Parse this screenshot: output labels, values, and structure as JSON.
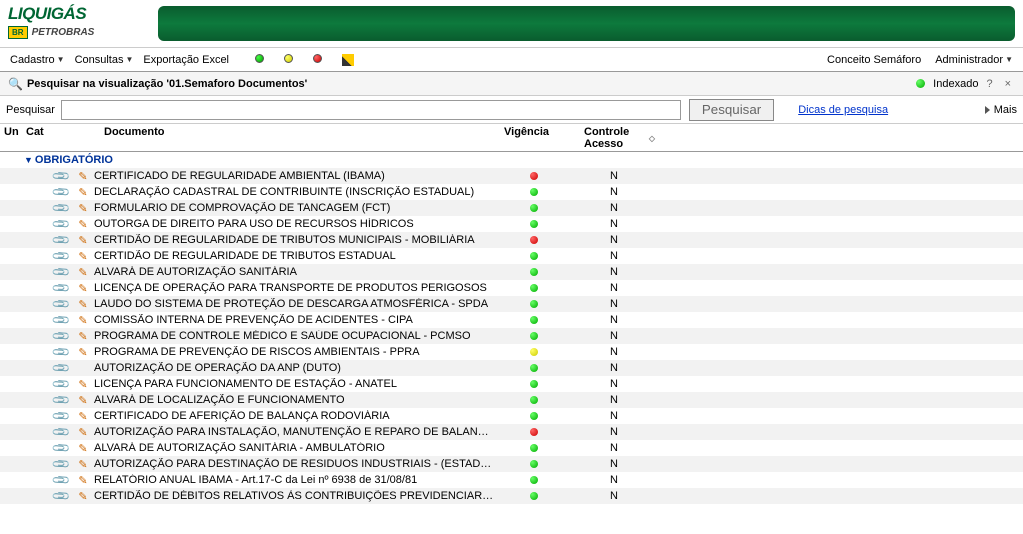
{
  "logo": {
    "main": "LIQUIGÁS",
    "br": "BR",
    "sub": "PETROBRAS"
  },
  "menu": {
    "cadastro": "Cadastro",
    "consultas": "Consultas",
    "exportacao": "Exportação Excel",
    "conceito": "Conceito Semáforo",
    "admin": "Administrador"
  },
  "searchHeader": {
    "title": "Pesquisar na visualização '01.Semaforo Documentos'",
    "indexed": "Indexado",
    "help": "?",
    "close": "×"
  },
  "searchRow": {
    "label": "Pesquisar",
    "button": "Pesquisar",
    "tips": "Dicas de pesquisa",
    "mais": "Mais"
  },
  "columns": {
    "un": "Un",
    "cat": "Cat",
    "doc": "Documento",
    "vig": "Vigência",
    "ctrl": "Controle Acesso"
  },
  "group": "OBRIGATÓRIO",
  "rows": [
    {
      "clip": true,
      "pencil": true,
      "doc": "CERTIFICADO DE REGULARIDADE AMBIENTAL (IBAMA)",
      "status": "red",
      "acesso": "N"
    },
    {
      "clip": true,
      "pencil": true,
      "doc": "DECLARAÇÃO CADASTRAL DE CONTRIBUINTE (INSCRIÇÃO ESTADUAL)",
      "status": "green",
      "acesso": "N"
    },
    {
      "clip": true,
      "pencil": true,
      "doc": "FORMULARIO DE COMPROVAÇÃO DE TANCAGEM (FCT)",
      "status": "green",
      "acesso": "N"
    },
    {
      "clip": true,
      "pencil": true,
      "doc": "OUTORGA DE DIREITO PARA USO DE RECURSOS HÍDRICOS",
      "status": "green",
      "acesso": "N"
    },
    {
      "clip": true,
      "pencil": true,
      "doc": "CERTIDÃO DE REGULARIDADE DE TRIBUTOS MUNICIPAIS - MOBILIÁRIA",
      "status": "red",
      "acesso": "N"
    },
    {
      "clip": true,
      "pencil": true,
      "doc": "CERTIDÃO DE REGULARIDADE DE TRIBUTOS ESTADUAL",
      "status": "green",
      "acesso": "N"
    },
    {
      "clip": true,
      "pencil": true,
      "doc": "ALVARÁ DE AUTORIZAÇÃO SANITÁRIA",
      "status": "green",
      "acesso": "N"
    },
    {
      "clip": true,
      "pencil": true,
      "doc": "LICENÇA DE OPERAÇÃO PARA TRANSPORTE DE PRODUTOS PERIGOSOS",
      "status": "green",
      "acesso": "N"
    },
    {
      "clip": true,
      "pencil": true,
      "doc": "LAUDO DO SISTEMA DE PROTEÇÃO DE DESCARGA ATMOSFÉRICA - SPDA",
      "status": "green",
      "acesso": "N"
    },
    {
      "clip": true,
      "pencil": true,
      "doc": "COMISSÃO INTERNA DE PREVENÇÃO DE ACIDENTES - CIPA",
      "status": "green",
      "acesso": "N"
    },
    {
      "clip": true,
      "pencil": true,
      "doc": "PROGRAMA  DE CONTROLE MÉDICO E SAÚDE OCUPACIONAL - PCMSO",
      "status": "green",
      "acesso": "N"
    },
    {
      "clip": true,
      "pencil": true,
      "doc": "PROGRAMA  DE PREVENÇÃO DE RISCOS AMBIENTAIS - PPRA",
      "status": "yellow",
      "acesso": "N"
    },
    {
      "clip": true,
      "pencil": false,
      "doc": "AUTORIZAÇÃO DE OPERAÇÃO DA ANP (DUTO)",
      "status": "green",
      "acesso": "N"
    },
    {
      "clip": true,
      "pencil": true,
      "doc": "LICENÇA PARA FUNCIONAMENTO DE ESTAÇÃO - ANATEL",
      "status": "green",
      "acesso": "N"
    },
    {
      "clip": true,
      "pencil": true,
      "doc": "ALVARÁ DE LOCALIZAÇÃO E FUNCIONAMENTO",
      "status": "green",
      "acesso": "N"
    },
    {
      "clip": true,
      "pencil": true,
      "doc": "CERTIFICADO DE AFERIÇÃO DE BALANÇA RODOVIÁRIA",
      "status": "green",
      "acesso": "N"
    },
    {
      "clip": true,
      "pencil": true,
      "doc": "AUTORIZAÇÃO PARA INSTALAÇÃO, MANUTENÇÃO E REPARO DE BALANÇAS",
      "status": "red",
      "acesso": "N"
    },
    {
      "clip": true,
      "pencil": true,
      "doc": "ALVARÁ DE AUTORIZAÇÃO SANITÁRIA - AMBULATÓRIO",
      "status": "green",
      "acesso": "N"
    },
    {
      "clip": true,
      "pencil": true,
      "doc": "AUTORIZAÇÃO PARA DESTINAÇÃO DE RESIDUOS INDUSTRIAIS - (ESTADO DE",
      "status": "green",
      "acesso": "N"
    },
    {
      "clip": true,
      "pencil": true,
      "doc": "RELATÓRIO ANUAL IBAMA - Art.17-C da Lei nº 6938 de 31/08/81",
      "status": "green",
      "acesso": "N"
    },
    {
      "clip": true,
      "pencil": true,
      "doc": "CERTIDÃO DE DÉBITOS RELATIVOS ÀS CONTRIBUIÇÕES PREVIDENCIARIAS IN",
      "status": "green",
      "acesso": "N"
    }
  ]
}
